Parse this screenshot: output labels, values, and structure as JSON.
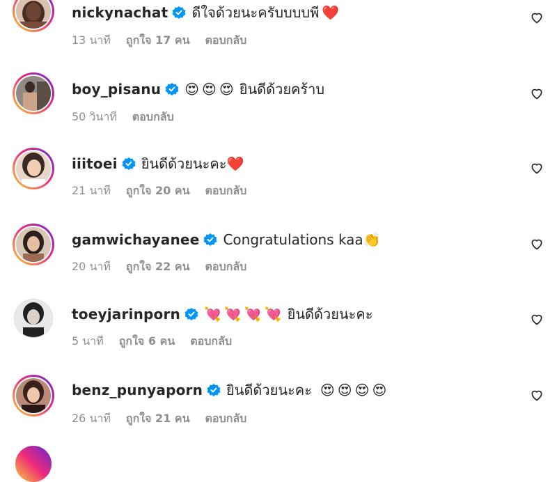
{
  "comments": [
    {
      "username": "nickynachat",
      "text": "ดีใจด้วยนะครับบบบพี",
      "emojis": [
        "❤️"
      ],
      "time": "13 นาที",
      "likes": "ถูกใจ 17 คน",
      "reply": "ตอบกลับ",
      "ring": true
    },
    {
      "username": "boy_pisanu",
      "text": "ยินดีด้วยคร้าบ",
      "emojis_before": [
        "😍",
        "😍",
        "😍"
      ],
      "emojis": [],
      "time": "50 วินาที",
      "likes": "",
      "reply": "ตอบกลับ",
      "ring": true
    },
    {
      "username": "iiitoei",
      "text": "ยินดีด้วยนะคะ",
      "emojis": [
        "❤️"
      ],
      "time": "21 นาที",
      "likes": "ถูกใจ 20 คน",
      "reply": "ตอบกลับ",
      "ring": true
    },
    {
      "username": "gamwichayanee",
      "text": "Congratulations kaa",
      "emojis": [
        "👏"
      ],
      "time": "20 นาที",
      "likes": "ถูกใจ 22 คน",
      "reply": "ตอบกลับ",
      "ring": true
    },
    {
      "username": "toeyjarinporn",
      "text": "ยินดีด้วยนะคะ",
      "emojis_before": [
        "💘",
        "💘",
        "💘",
        "💘"
      ],
      "emojis": [],
      "time": "5 นาที",
      "likes": "ถูกใจ 6 คน",
      "reply": "ตอบกลับ",
      "ring": false
    },
    {
      "username": "benz_punyaporn",
      "text": "ยินดีด้วยนะคะ",
      "emojis": [
        "😍",
        "😍",
        "😍",
        "😍"
      ],
      "time": "26 นาที",
      "likes": "ถูกใจ 21 คน",
      "reply": "ตอบกลับ",
      "ring": true
    }
  ],
  "colors": {
    "verified": "#0095f6",
    "meta": "#8e8e8e",
    "text": "#262626"
  },
  "icons": {
    "verified": "verified-badge-icon",
    "like": "heart-outline-icon"
  }
}
